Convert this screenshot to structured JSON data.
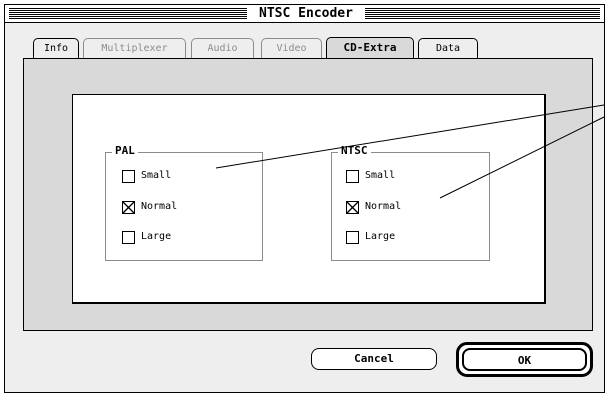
{
  "window": {
    "title": "NTSC Encoder"
  },
  "tabs": [
    {
      "label": "Info",
      "state": "enabled"
    },
    {
      "label": "Multiplexer",
      "state": "disabled"
    },
    {
      "label": "Audio",
      "state": "disabled"
    },
    {
      "label": "Video",
      "state": "disabled"
    },
    {
      "label": "CD-Extra",
      "state": "active"
    },
    {
      "label": "Data",
      "state": "enabled"
    }
  ],
  "pal_group": {
    "title": "PAL",
    "options": [
      {
        "label": "Small",
        "checked": false
      },
      {
        "label": "Normal",
        "checked": true
      },
      {
        "label": "Large",
        "checked": false
      }
    ]
  },
  "ntsc_group": {
    "title": "NTSC",
    "options": [
      {
        "label": "Small",
        "checked": false
      },
      {
        "label": "Normal",
        "checked": true
      },
      {
        "label": "Large",
        "checked": false
      }
    ]
  },
  "buttons": {
    "cancel_label": "Cancel",
    "ok_label": "OK"
  }
}
